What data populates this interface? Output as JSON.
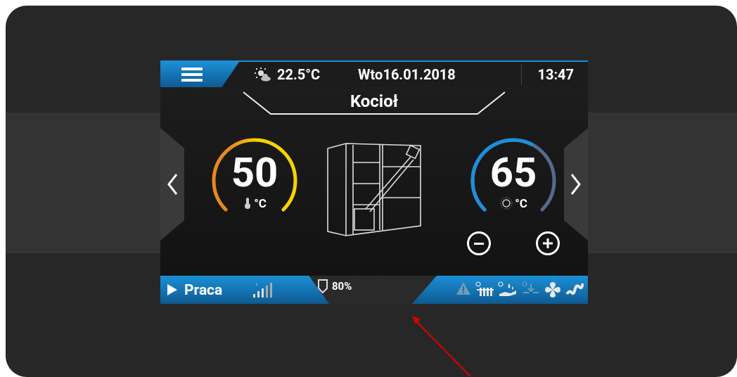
{
  "header": {
    "weather": "22.5°C",
    "date": "Wto16.01.2018",
    "time": "13:47"
  },
  "title": "Kocioł",
  "gauges": [
    {
      "kind": "actual",
      "value": "50",
      "unit": "°C"
    },
    {
      "kind": "setpoint",
      "value": "65",
      "unit": "°C"
    }
  ],
  "status_bar": {
    "mode": "Praca",
    "fuel_level": "80%",
    "indicators": [
      {
        "kind": "warning",
        "on": false
      },
      {
        "kind": "radiator",
        "on": true
      },
      {
        "kind": "hot-water",
        "on": true
      },
      {
        "kind": "valve",
        "on": false
      },
      {
        "kind": "fan",
        "on": true
      },
      {
        "kind": "feeder",
        "on": true
      }
    ]
  }
}
